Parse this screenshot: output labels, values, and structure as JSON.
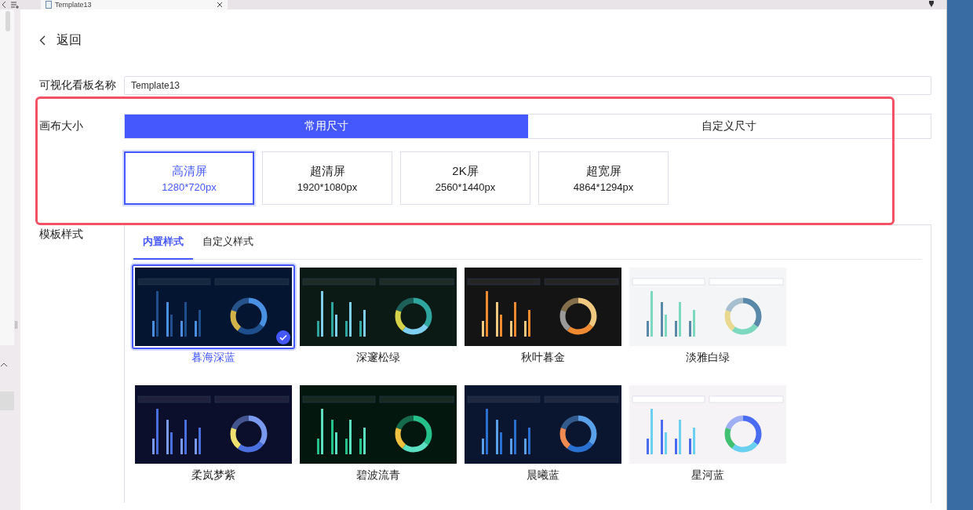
{
  "tab": {
    "title": "Template13"
  },
  "back": {
    "label": "返回"
  },
  "name_field": {
    "label": "可视化看板名称",
    "value": "Template13"
  },
  "canvas_size": {
    "label": "画布大小",
    "modes": [
      {
        "label": "常用尺寸",
        "selected": true
      },
      {
        "label": "自定义尺寸",
        "selected": false
      }
    ],
    "sizes": [
      {
        "name": "高清屏",
        "resolution": "1280*720px",
        "selected": true
      },
      {
        "name": "超清屏",
        "resolution": "1920*1080px",
        "selected": false
      },
      {
        "name": "2K屏",
        "resolution": "2560*1440px",
        "selected": false
      },
      {
        "name": "超宽屏",
        "resolution": "4864*1294px",
        "selected": false
      }
    ]
  },
  "template_style": {
    "label": "模板样式",
    "tabs": [
      {
        "label": "内置样式",
        "selected": true
      },
      {
        "label": "自定义样式",
        "selected": false
      }
    ],
    "themes": [
      {
        "name": "暮海深蓝",
        "selected": true
      },
      {
        "name": "深邃松绿",
        "selected": false
      },
      {
        "name": "秋叶暮金",
        "selected": false
      },
      {
        "name": "淡雅白绿",
        "selected": false
      },
      {
        "name": "柔岚梦紫",
        "selected": false
      },
      {
        "name": "碧波流青",
        "selected": false
      },
      {
        "name": "晨曦蓝",
        "selected": false
      },
      {
        "name": "星河蓝",
        "selected": false
      }
    ]
  }
}
